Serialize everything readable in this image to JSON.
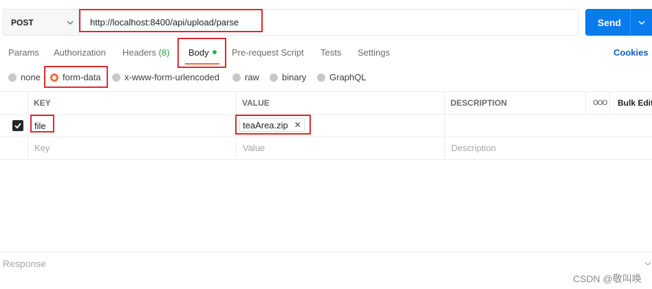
{
  "request": {
    "method": "POST",
    "url": "http://localhost:8400/api/upload/parse",
    "send_label": "Send"
  },
  "tabs": [
    {
      "label": "Params"
    },
    {
      "label": "Authorization"
    },
    {
      "label": "Headers",
      "count": "(8)"
    },
    {
      "label": "Body",
      "active": true
    },
    {
      "label": "Pre-request Script"
    },
    {
      "label": "Tests"
    },
    {
      "label": "Settings"
    }
  ],
  "cookies_label": "Cookies",
  "body_types": [
    {
      "label": "none",
      "selected": false
    },
    {
      "label": "form-data",
      "selected": true
    },
    {
      "label": "x-www-form-urlencoded",
      "selected": false
    },
    {
      "label": "raw",
      "selected": false
    },
    {
      "label": "binary",
      "selected": false
    },
    {
      "label": "GraphQL",
      "selected": false
    }
  ],
  "table": {
    "headers": {
      "key": "KEY",
      "value": "VALUE",
      "description": "DESCRIPTION",
      "more": "ooo",
      "bulk_edit": "Bulk Edit"
    },
    "rows": [
      {
        "checked": true,
        "key": "file",
        "value_file": "teaArea.zip",
        "description": ""
      }
    ],
    "placeholders": {
      "key": "Key",
      "value": "Value",
      "description": "Description"
    }
  },
  "response_label": "Response",
  "watermark": "CSDN @敬叫唤",
  "colors": {
    "accent": "#f26b3a",
    "send": "#097bed",
    "annotation": "#e0262c",
    "cookies": "#0b5fc4"
  }
}
